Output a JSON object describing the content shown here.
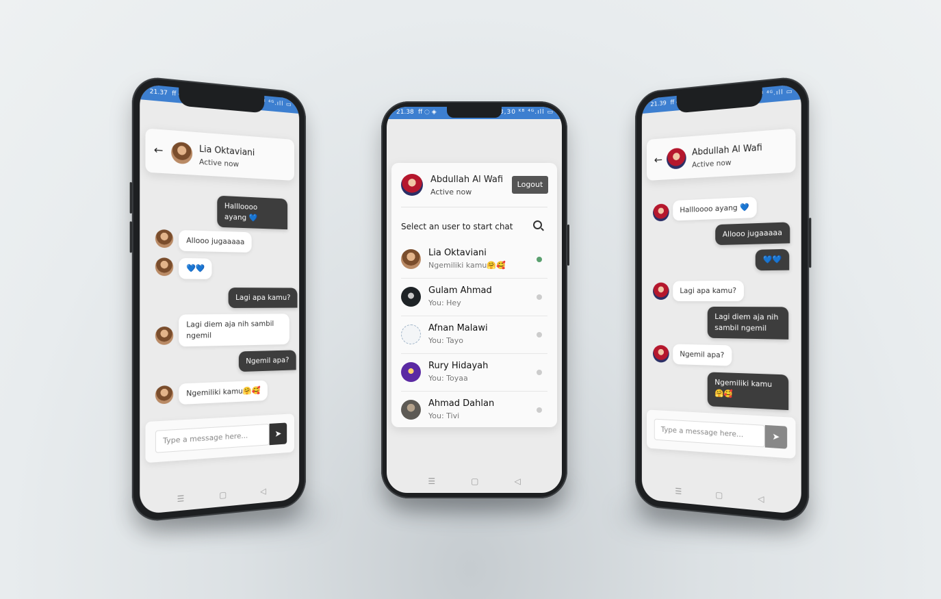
{
  "left_phone": {
    "status": {
      "time": "21.37",
      "left_icons": "ff ◌ ◈",
      "right_icons": "⏰ 2,00 ᴷᴮ ⁴ᴳ.ıll ▭"
    },
    "header": {
      "name": "Lia Oktaviani",
      "status": "Active now"
    },
    "messages": [
      {
        "from": "me",
        "text": "Hallloooo ayang 💙"
      },
      {
        "from": "them",
        "text": "Allooo jugaaaaa"
      },
      {
        "from": "them",
        "text": "💙💙"
      },
      {
        "from": "me",
        "text": "Lagi apa kamu?"
      },
      {
        "from": "them",
        "text": "Lagi diem aja nih sambil ngemil"
      },
      {
        "from": "me",
        "text": "Ngemil apa?"
      },
      {
        "from": "them",
        "text": "Ngemiliki kamu🤗🥰"
      }
    ],
    "input": {
      "placeholder": "Type a message here..."
    }
  },
  "center_phone": {
    "status": {
      "time": "21.38",
      "left_icons": "ff ◌ ◈",
      "right_icons": "⏰ 3,30 ᴷᴮ ⁴ᴳ.ıll ▭"
    },
    "header": {
      "name": "Abdullah Al Wafi",
      "status": "Active now",
      "logout_label": "Logout"
    },
    "search_prompt": "Select an user to start chat",
    "users": [
      {
        "name": "Lia Oktaviani",
        "last": "Ngemiliki kamu🤗🥰",
        "online": true,
        "avatar": "av-lia"
      },
      {
        "name": "Gulam Ahmad",
        "last": "You: Hey",
        "online": false,
        "avatar": "av-gulam"
      },
      {
        "name": "Afnan Malawi",
        "last": "You: Tayo",
        "online": false,
        "avatar": "av-afnan"
      },
      {
        "name": "Rury Hidayah",
        "last": "You: Toyaa",
        "online": false,
        "avatar": "av-rury"
      },
      {
        "name": "Ahmad Dahlan",
        "last": "You: Tivi",
        "online": false,
        "avatar": "av-ahmad"
      }
    ]
  },
  "right_phone": {
    "status": {
      "time": "21.39",
      "left_icons": "ff ◌ ☁ ◈",
      "right_icons": "⏰ 3,80 ᴷᴮ ⁴ᴳ.ıll ▭"
    },
    "header": {
      "name": "Abdullah Al Wafi",
      "status": "Active now"
    },
    "messages": [
      {
        "from": "them",
        "text": "Hallloooo ayang 💙"
      },
      {
        "from": "me",
        "text": "Allooo jugaaaaa"
      },
      {
        "from": "me",
        "text": "💙💙"
      },
      {
        "from": "them",
        "text": "Lagi apa kamu?"
      },
      {
        "from": "me",
        "text": "Lagi diem aja nih sambil ngemil"
      },
      {
        "from": "them",
        "text": "Ngemil apa?"
      },
      {
        "from": "me",
        "text": "Ngemiliki kamu🤗🥰"
      }
    ],
    "input": {
      "placeholder": "Type a message here..."
    }
  },
  "nav_icons": {
    "menu": "☰",
    "home": "▢",
    "back": "◁"
  },
  "colors": {
    "statusbar": "#3d7fd0",
    "bubble_out": "#3d3d3d",
    "online": "#5aa06f"
  }
}
